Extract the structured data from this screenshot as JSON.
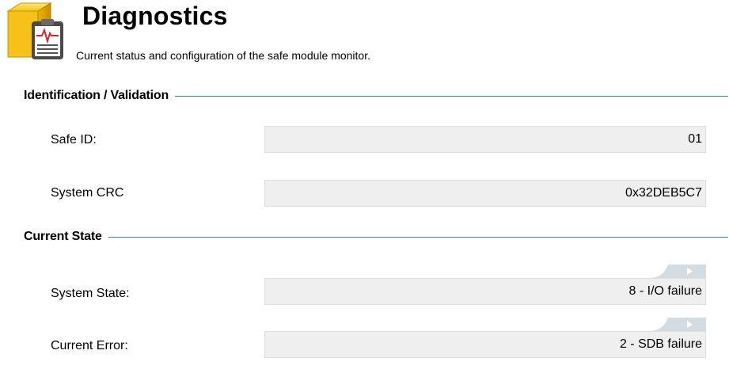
{
  "header": {
    "title": "Diagnostics",
    "subtitle": "Current status and configuration of the safe module monitor.",
    "icon": "diagnostics-clipboard-icon"
  },
  "sections": [
    {
      "title": "Identification / Validation",
      "fields": [
        {
          "label": "Safe ID:",
          "value": "01"
        },
        {
          "label": "System CRC",
          "value": "0x32DEB5C7"
        }
      ]
    },
    {
      "title": "Current State",
      "fields": [
        {
          "label": "System State:",
          "value": "8 - I/O failure"
        },
        {
          "label": "Current Error:",
          "value": "2 - SDB failure"
        }
      ]
    }
  ],
  "colors": {
    "section_line": "#2e86c8",
    "field_background": "#efefef",
    "icon_box": "#f2c21a"
  }
}
